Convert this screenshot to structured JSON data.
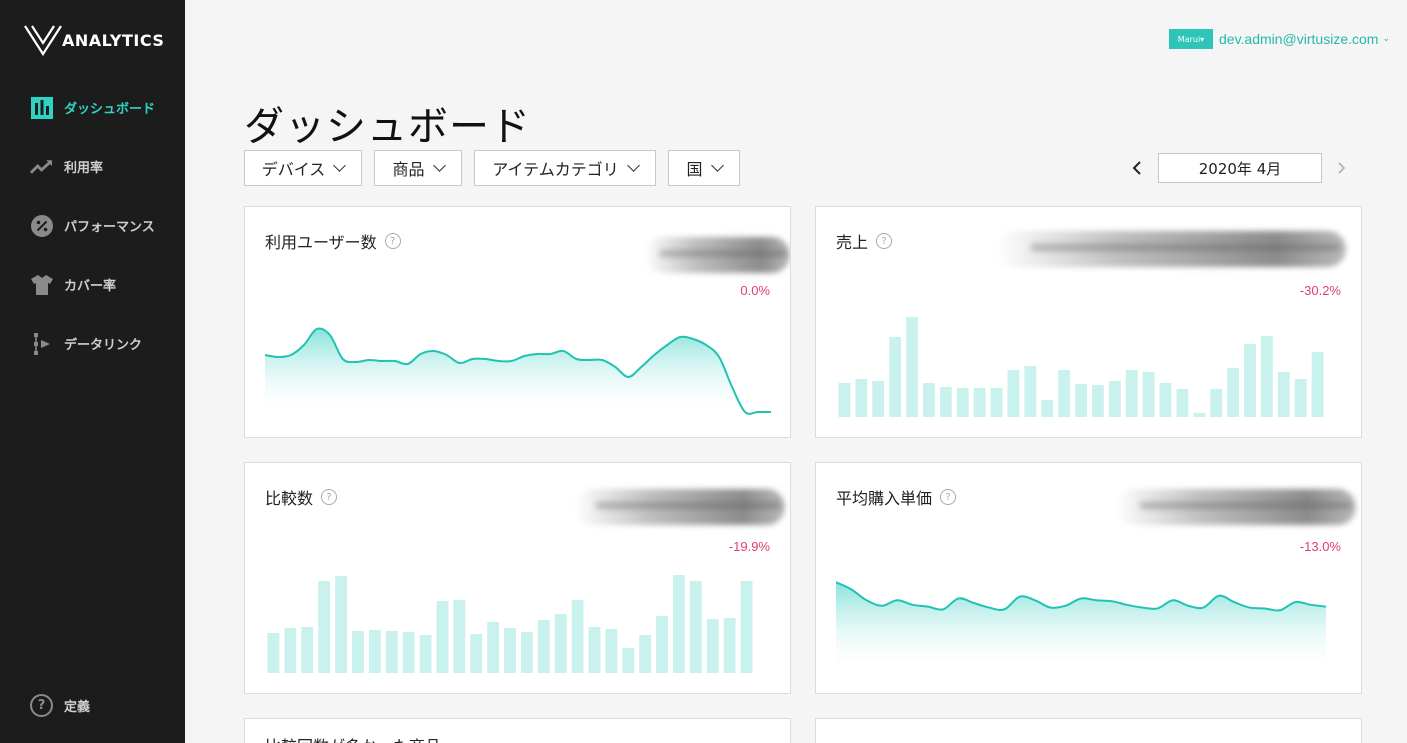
{
  "brand": {
    "logo_text": "ANALYTICS"
  },
  "sidebar": {
    "items": [
      {
        "label": "ダッシュボード",
        "icon": "bar-chart-icon",
        "active": true
      },
      {
        "label": "利用率",
        "icon": "trend-up-icon",
        "active": false
      },
      {
        "label": "パフォーマンス",
        "icon": "percent-icon",
        "active": false
      },
      {
        "label": "カバー率",
        "icon": "shirt-icon",
        "active": false
      },
      {
        "label": "データリンク",
        "icon": "data-link-icon",
        "active": false
      }
    ],
    "bottom": {
      "label": "定義",
      "icon": "help-icon"
    }
  },
  "header": {
    "store_badge": "Marui▾",
    "user_email": "dev.admin@virtusize.com",
    "page_title": "ダッシュボード"
  },
  "filters": [
    {
      "label": "デバイス"
    },
    {
      "label": "商品"
    },
    {
      "label": "アイテムカテゴリ"
    },
    {
      "label": "国"
    }
  ],
  "date_picker": {
    "value": "2020年 4月"
  },
  "colors": {
    "accent": "#2ed3c4",
    "bar_fill": "#c9f1ee",
    "line": "#1fc3b3",
    "negative": "#e0406a",
    "sidebar_bg": "#1c1c1c"
  },
  "cards": [
    {
      "title": "利用ユーザー数",
      "change": "0.0%"
    },
    {
      "title": "売上",
      "change": "-30.2%"
    },
    {
      "title": "比較数",
      "change": "-19.9%"
    },
    {
      "title": "平均購入単価",
      "change": "-13.0%"
    },
    {
      "title": "比較回数が多かった商品",
      "change": ""
    },
    {
      "title": "",
      "change": ""
    }
  ],
  "chart_data": [
    {
      "type": "area",
      "title": "利用ユーザー数",
      "y": [
        62,
        60,
        62,
        72,
        88,
        82,
        58,
        55,
        57,
        56,
        56,
        53,
        63,
        66,
        62,
        54,
        58,
        58,
        56,
        56,
        61,
        63,
        63,
        66,
        58,
        57,
        57,
        50,
        40,
        50,
        62,
        72,
        80,
        78,
        72,
        60,
        30,
        5,
        5,
        5
      ],
      "ylim": [
        0,
        100
      ]
    },
    {
      "type": "bar",
      "title": "売上",
      "values": [
        34,
        38,
        36,
        80,
        100,
        34,
        30,
        29,
        29,
        29,
        47,
        51,
        17,
        47,
        33,
        32,
        36,
        47,
        45,
        34,
        28,
        4,
        28,
        49,
        73,
        81,
        45,
        38,
        65
      ],
      "ylim": [
        0,
        100
      ]
    },
    {
      "type": "bar",
      "title": "比較数",
      "values": [
        40,
        45,
        46,
        92,
        97,
        42,
        43,
        42,
        41,
        38,
        72,
        73,
        39,
        51,
        45,
        41,
        53,
        59,
        73,
        46,
        44,
        25,
        38,
        57,
        98,
        92,
        54,
        55,
        92
      ],
      "ylim": [
        0,
        100
      ]
    },
    {
      "type": "area",
      "title": "平均購入単価",
      "y": [
        100,
        92,
        80,
        74,
        80,
        75,
        73,
        70,
        82,
        77,
        72,
        70,
        84,
        80,
        72,
        74,
        82,
        80,
        79,
        75,
        72,
        71,
        80,
        74,
        72,
        85,
        78,
        72,
        71,
        69,
        78,
        75,
        73
      ],
      "ylim": [
        0,
        110
      ]
    }
  ]
}
